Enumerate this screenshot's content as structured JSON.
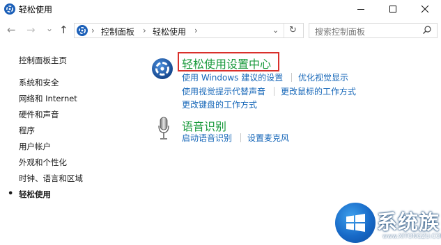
{
  "window": {
    "title": "轻松使用"
  },
  "nav": {
    "back": "←",
    "forward": "→",
    "recent": "⌄",
    "up": "↑"
  },
  "address": {
    "crumbs": [
      "控制面板",
      "轻松使用"
    ]
  },
  "search": {
    "placeholder": "搜索控制面板"
  },
  "sidebar": {
    "items": [
      {
        "label": "控制面板主页"
      },
      {
        "label": "系统和安全"
      },
      {
        "label": "网络和 Internet"
      },
      {
        "label": "硬件和声音"
      },
      {
        "label": "程序"
      },
      {
        "label": "用户帐户"
      },
      {
        "label": "外观和个性化"
      },
      {
        "label": "时钟、语言和区域"
      },
      {
        "label": "轻松使用",
        "current": true
      }
    ]
  },
  "main": {
    "ease_center": {
      "title": "轻松使用设置中心",
      "links": [
        "使用 Windows 建议的设置",
        "优化视觉显示",
        "使用视觉提示代替声音",
        "更改鼠标的工作方式",
        "更改键盘的工作方式"
      ]
    },
    "speech": {
      "title": "语音识别",
      "links": [
        "启动语音识别",
        "设置麦克风"
      ]
    }
  },
  "watermark": {
    "brand": "系统族",
    "url": "www.XITONGZU.COM"
  },
  "colors": {
    "link": "#1566b8",
    "heading": "#1a9a3c",
    "highlight": "#d9302b"
  }
}
